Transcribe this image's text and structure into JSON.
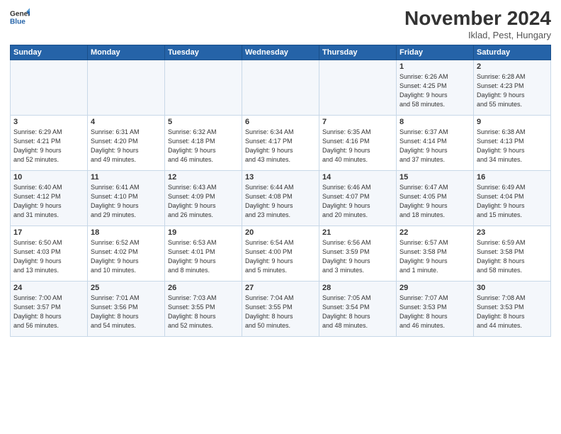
{
  "logo": {
    "line1": "General",
    "line2": "Blue"
  },
  "title": "November 2024",
  "location": "Iklad, Pest, Hungary",
  "days_header": [
    "Sunday",
    "Monday",
    "Tuesday",
    "Wednesday",
    "Thursday",
    "Friday",
    "Saturday"
  ],
  "weeks": [
    [
      {
        "num": "",
        "info": ""
      },
      {
        "num": "",
        "info": ""
      },
      {
        "num": "",
        "info": ""
      },
      {
        "num": "",
        "info": ""
      },
      {
        "num": "",
        "info": ""
      },
      {
        "num": "1",
        "info": "Sunrise: 6:26 AM\nSunset: 4:25 PM\nDaylight: 9 hours\nand 58 minutes."
      },
      {
        "num": "2",
        "info": "Sunrise: 6:28 AM\nSunset: 4:23 PM\nDaylight: 9 hours\nand 55 minutes."
      }
    ],
    [
      {
        "num": "3",
        "info": "Sunrise: 6:29 AM\nSunset: 4:21 PM\nDaylight: 9 hours\nand 52 minutes."
      },
      {
        "num": "4",
        "info": "Sunrise: 6:31 AM\nSunset: 4:20 PM\nDaylight: 9 hours\nand 49 minutes."
      },
      {
        "num": "5",
        "info": "Sunrise: 6:32 AM\nSunset: 4:18 PM\nDaylight: 9 hours\nand 46 minutes."
      },
      {
        "num": "6",
        "info": "Sunrise: 6:34 AM\nSunset: 4:17 PM\nDaylight: 9 hours\nand 43 minutes."
      },
      {
        "num": "7",
        "info": "Sunrise: 6:35 AM\nSunset: 4:16 PM\nDaylight: 9 hours\nand 40 minutes."
      },
      {
        "num": "8",
        "info": "Sunrise: 6:37 AM\nSunset: 4:14 PM\nDaylight: 9 hours\nand 37 minutes."
      },
      {
        "num": "9",
        "info": "Sunrise: 6:38 AM\nSunset: 4:13 PM\nDaylight: 9 hours\nand 34 minutes."
      }
    ],
    [
      {
        "num": "10",
        "info": "Sunrise: 6:40 AM\nSunset: 4:12 PM\nDaylight: 9 hours\nand 31 minutes."
      },
      {
        "num": "11",
        "info": "Sunrise: 6:41 AM\nSunset: 4:10 PM\nDaylight: 9 hours\nand 29 minutes."
      },
      {
        "num": "12",
        "info": "Sunrise: 6:43 AM\nSunset: 4:09 PM\nDaylight: 9 hours\nand 26 minutes."
      },
      {
        "num": "13",
        "info": "Sunrise: 6:44 AM\nSunset: 4:08 PM\nDaylight: 9 hours\nand 23 minutes."
      },
      {
        "num": "14",
        "info": "Sunrise: 6:46 AM\nSunset: 4:07 PM\nDaylight: 9 hours\nand 20 minutes."
      },
      {
        "num": "15",
        "info": "Sunrise: 6:47 AM\nSunset: 4:05 PM\nDaylight: 9 hours\nand 18 minutes."
      },
      {
        "num": "16",
        "info": "Sunrise: 6:49 AM\nSunset: 4:04 PM\nDaylight: 9 hours\nand 15 minutes."
      }
    ],
    [
      {
        "num": "17",
        "info": "Sunrise: 6:50 AM\nSunset: 4:03 PM\nDaylight: 9 hours\nand 13 minutes."
      },
      {
        "num": "18",
        "info": "Sunrise: 6:52 AM\nSunset: 4:02 PM\nDaylight: 9 hours\nand 10 minutes."
      },
      {
        "num": "19",
        "info": "Sunrise: 6:53 AM\nSunset: 4:01 PM\nDaylight: 9 hours\nand 8 minutes."
      },
      {
        "num": "20",
        "info": "Sunrise: 6:54 AM\nSunset: 4:00 PM\nDaylight: 9 hours\nand 5 minutes."
      },
      {
        "num": "21",
        "info": "Sunrise: 6:56 AM\nSunset: 3:59 PM\nDaylight: 9 hours\nand 3 minutes."
      },
      {
        "num": "22",
        "info": "Sunrise: 6:57 AM\nSunset: 3:58 PM\nDaylight: 9 hours\nand 1 minute."
      },
      {
        "num": "23",
        "info": "Sunrise: 6:59 AM\nSunset: 3:58 PM\nDaylight: 8 hours\nand 58 minutes."
      }
    ],
    [
      {
        "num": "24",
        "info": "Sunrise: 7:00 AM\nSunset: 3:57 PM\nDaylight: 8 hours\nand 56 minutes."
      },
      {
        "num": "25",
        "info": "Sunrise: 7:01 AM\nSunset: 3:56 PM\nDaylight: 8 hours\nand 54 minutes."
      },
      {
        "num": "26",
        "info": "Sunrise: 7:03 AM\nSunset: 3:55 PM\nDaylight: 8 hours\nand 52 minutes."
      },
      {
        "num": "27",
        "info": "Sunrise: 7:04 AM\nSunset: 3:55 PM\nDaylight: 8 hours\nand 50 minutes."
      },
      {
        "num": "28",
        "info": "Sunrise: 7:05 AM\nSunset: 3:54 PM\nDaylight: 8 hours\nand 48 minutes."
      },
      {
        "num": "29",
        "info": "Sunrise: 7:07 AM\nSunset: 3:53 PM\nDaylight: 8 hours\nand 46 minutes."
      },
      {
        "num": "30",
        "info": "Sunrise: 7:08 AM\nSunset: 3:53 PM\nDaylight: 8 hours\nand 44 minutes."
      }
    ]
  ]
}
